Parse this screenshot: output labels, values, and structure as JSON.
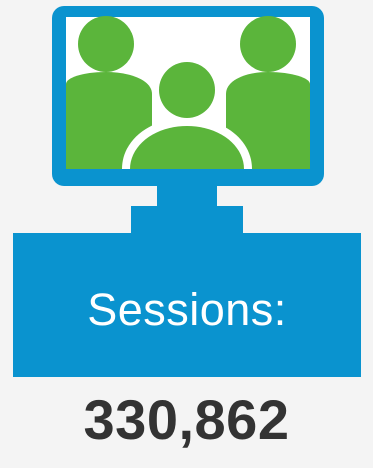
{
  "colors": {
    "background": "#f4f4f4",
    "monitor_blue": "#0a93cf",
    "screen_white": "#ffffff",
    "people_green": "#5bb53b",
    "value_text": "#333333"
  },
  "icon": {
    "name": "monitor-people-icon"
  },
  "panel": {
    "label": "Sessions:"
  },
  "stat": {
    "value": "330,862"
  }
}
